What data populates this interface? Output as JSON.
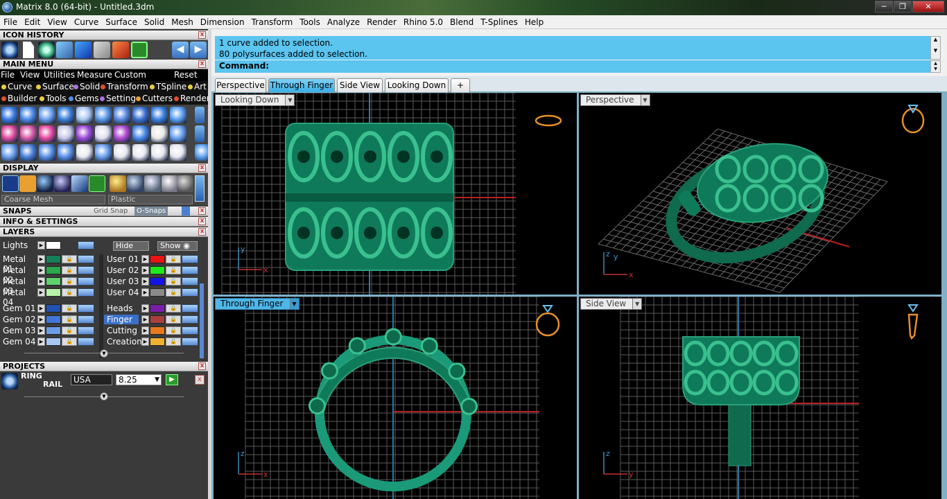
{
  "window": {
    "title": "Matrix 8.0 (64-bit) - Untitled.3dm",
    "min": "─",
    "max": "❐",
    "close": "✕"
  },
  "menubar": [
    "File",
    "Edit",
    "View",
    "Curve",
    "Surface",
    "Solid",
    "Mesh",
    "Dimension",
    "Transform",
    "Tools",
    "Analyze",
    "Render",
    "Rhino 5.0",
    "Blend",
    "T-Splines",
    "Help"
  ],
  "panels": {
    "icon_history": "ICON HISTORY",
    "main_menu": "MAIN MENU",
    "display": "DISPLAY",
    "snaps": "SNAPS",
    "info": "INFO & SETTINGS",
    "layers": "LAYERS",
    "projects": "PROJECTS"
  },
  "main_menu": {
    "row1": [
      "File",
      "View",
      "Utilities",
      "Measure",
      "Custom"
    ],
    "reset": "Reset",
    "row2": [
      "Curve",
      "Surface",
      "Solid",
      "Transform",
      "TSpline",
      "Art"
    ],
    "row3": [
      "Builder",
      "Tools",
      "Gems",
      "Setting",
      "Cutters",
      "Render"
    ]
  },
  "display": {
    "mesh": "Coarse Mesh",
    "material": "Plastic"
  },
  "snaps": {
    "grid": "Grid Snap",
    "osnaps": "O-Snaps"
  },
  "layers": {
    "lights": "Lights",
    "hide": "Hide",
    "show": "Show",
    "left": [
      {
        "name": "Metal 01",
        "color": "#16805a"
      },
      {
        "name": "Metal 02",
        "color": "#2aa84a"
      },
      {
        "name": "Metal 03",
        "color": "#5fd26e"
      },
      {
        "name": "Metal 04",
        "color": "#b6f3a8"
      },
      {
        "name": "Gem 01",
        "color": "#2153b0"
      },
      {
        "name": "Gem 02",
        "color": "#3f78d8"
      },
      {
        "name": "Gem 03",
        "color": "#6d9ce8"
      },
      {
        "name": "Gem 04",
        "color": "#a8c6f2"
      }
    ],
    "right": [
      {
        "name": "User 01",
        "color": "#e81414"
      },
      {
        "name": "User 02",
        "color": "#1ee81e"
      },
      {
        "name": "User 03",
        "color": "#1414e8"
      },
      {
        "name": "User 04",
        "color": "#8a8a8a"
      },
      {
        "name": "Heads",
        "color": "#7a1ea8"
      },
      {
        "name": "Finger",
        "color": "#a84040"
      },
      {
        "name": "Cutting",
        "color": "#e8781e"
      },
      {
        "name": "Creation",
        "color": "#f0b030"
      }
    ]
  },
  "projects": {
    "line1": "RING",
    "line2": "RAIL",
    "country": "USA",
    "size": "8.25"
  },
  "command": {
    "history": [
      "1 curve added to selection.",
      "80 polysurfaces added to selection."
    ],
    "prompt": "Command:"
  },
  "view_tabs": [
    "Perspective",
    "Through Finger",
    "Side View",
    "Looking Down"
  ],
  "active_tab": "Through Finger",
  "add_tab": "+",
  "viewports": [
    {
      "name": "Looking Down",
      "active": false,
      "axes": [
        "y",
        "x"
      ]
    },
    {
      "name": "Perspective",
      "active": false,
      "axes": [
        "z",
        "y",
        "x"
      ]
    },
    {
      "name": "Through Finger",
      "active": true,
      "axes": [
        "z",
        "x"
      ]
    },
    {
      "name": "Side View",
      "active": false,
      "axes": [
        "z",
        "y"
      ]
    }
  ],
  "colors": {
    "accent": "#4fb6e8",
    "model": "#0f7a5a",
    "grid": "#5a5a5a",
    "widget": "#e8902a"
  }
}
